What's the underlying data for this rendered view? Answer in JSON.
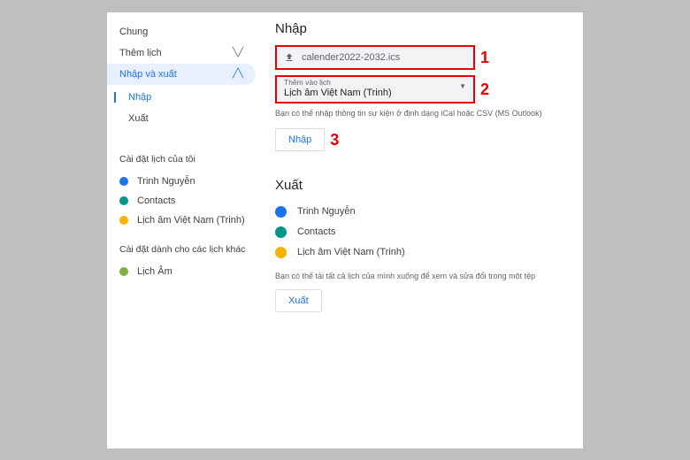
{
  "sidebar": {
    "general": "Chung",
    "add_calendar": "Thêm lịch",
    "import_export": "Nhập và xuất",
    "sub_import": "Nhập",
    "sub_export": "Xuất",
    "my_calendars_title": "Cài đặt lịch của tôi",
    "my_calendars": [
      {
        "label": "Trinh Nguyễn",
        "color": "#1a73e8"
      },
      {
        "label": "Contacts",
        "color": "#009688"
      },
      {
        "label": "Lịch âm Việt Nam (Trinh)",
        "color": "#f4b400"
      }
    ],
    "other_calendars_title": "Cài đặt dành cho các lịch khác",
    "other_calendars": [
      {
        "label": "Lịch Âm",
        "color": "#7cb342"
      }
    ]
  },
  "import": {
    "title": "Nhập",
    "file_name": "calender2022-2032.ics",
    "dropdown_label": "Thêm vào lịch",
    "dropdown_value": "Lịch âm Việt Nam (Trinh)",
    "hint": "Bạn có thể nhập thông tin sự kiện ở định dạng iCal hoặc CSV (MS Outlook)",
    "button": "Nhập"
  },
  "export": {
    "title": "Xuất",
    "items": [
      {
        "label": "Trinh Nguyễn",
        "color": "#1a73e8"
      },
      {
        "label": "Contacts",
        "color": "#009688"
      },
      {
        "label": "Lịch âm Việt Nam (Trinh)",
        "color": "#f4b400"
      }
    ],
    "hint": "Bạn có thể tải tất cả lịch của mình xuống để xem và sửa đổi trong một tệp",
    "button": "Xuất"
  },
  "annotations": {
    "n1": "1",
    "n2": "2",
    "n3": "3"
  }
}
